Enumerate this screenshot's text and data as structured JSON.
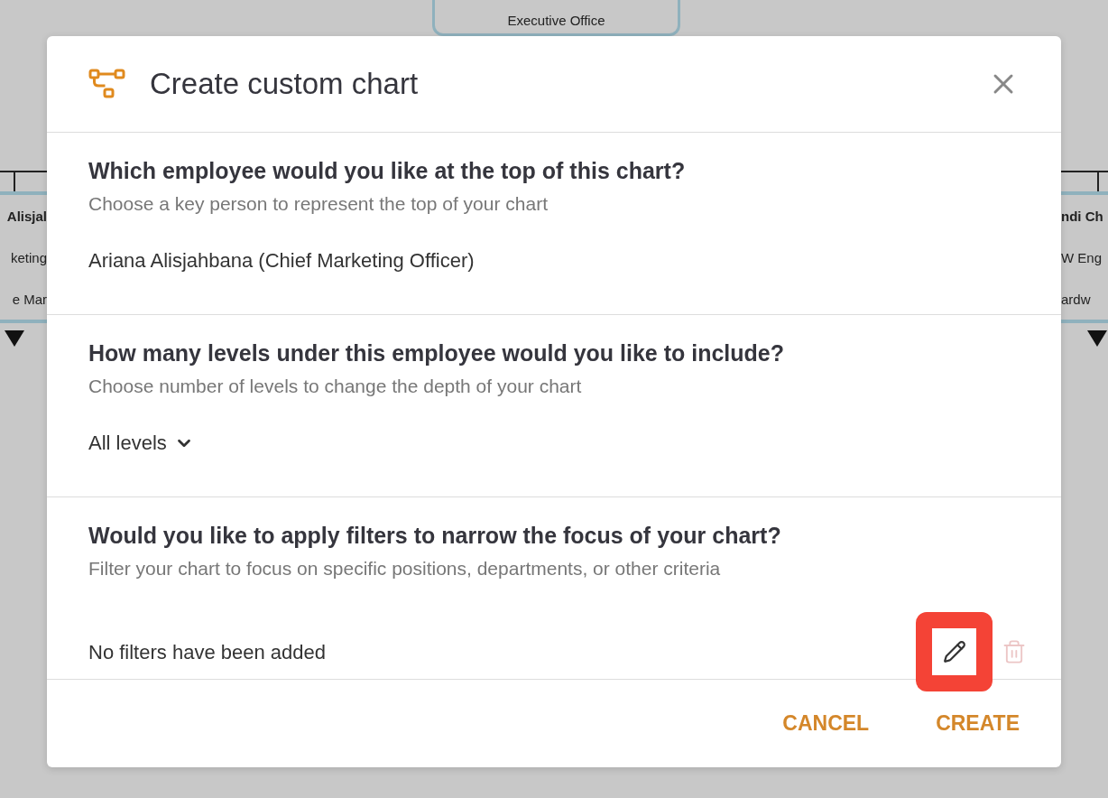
{
  "background_chart": {
    "nodes": [
      {
        "kind": "top",
        "lines": [
          {
            "text": "Executive Office",
            "bold": false
          }
        ]
      },
      {
        "kind": "left",
        "lines": [
          {
            "text": "Alisjal",
            "bold": true
          },
          {
            "text": "keting",
            "bold": false
          },
          {
            "text": "e Mar",
            "bold": false
          }
        ]
      },
      {
        "kind": "right",
        "lines": [
          {
            "text": "ndi Ch",
            "bold": true
          },
          {
            "text": "W Eng",
            "bold": false
          },
          {
            "text": "ardw",
            "bold": false
          }
        ]
      }
    ]
  },
  "dialog": {
    "title": "Create custom chart",
    "sections": [
      {
        "kind": "text",
        "question": "Which employee would you like at the top of this chart?",
        "hint": "Choose a key person to represent the top of your chart",
        "value": "Ariana Alisjahbana (Chief Marketing Officer)"
      },
      {
        "kind": "dropdown",
        "question": "How many levels under this employee would you like to include?",
        "hint": "Choose number of levels to change the depth of your chart",
        "value": "All levels"
      },
      {
        "kind": "filters",
        "question": "Would you like to apply filters to narrow the focus of your chart?",
        "hint": "Filter your chart to focus on specific positions, departments, or other criteria",
        "value": "No filters have been added",
        "edit": {
          "highlighted": true
        },
        "delete": {
          "disabled": true
        }
      }
    ],
    "buttons": [
      "CANCEL",
      "CREATE"
    ]
  }
}
